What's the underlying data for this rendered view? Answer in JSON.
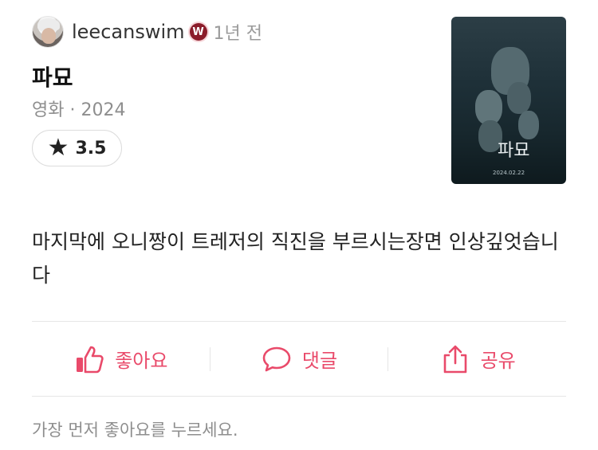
{
  "user": {
    "username": "leecanswim",
    "badge_letter": "W",
    "time_ago": "1년 전"
  },
  "movie": {
    "title": "파묘",
    "meta": "영화 · 2024",
    "rating_star": "★",
    "rating": "3.5",
    "poster": {
      "title_text": "파묘",
      "date_text": "2024.02.22"
    }
  },
  "review": {
    "text": "마지막에 오니짱이 트레저의 직진을 부르시는장면 인상깊엇습니다"
  },
  "actions": {
    "like_label": "좋아요",
    "comment_label": "댓글",
    "share_label": "공유"
  },
  "footer": {
    "text": "가장 먼저 좋아요를 누르세요."
  },
  "colors": {
    "accent": "#e94a6a",
    "muted": "#8e8e8e",
    "badge": "#8b1c2a"
  }
}
